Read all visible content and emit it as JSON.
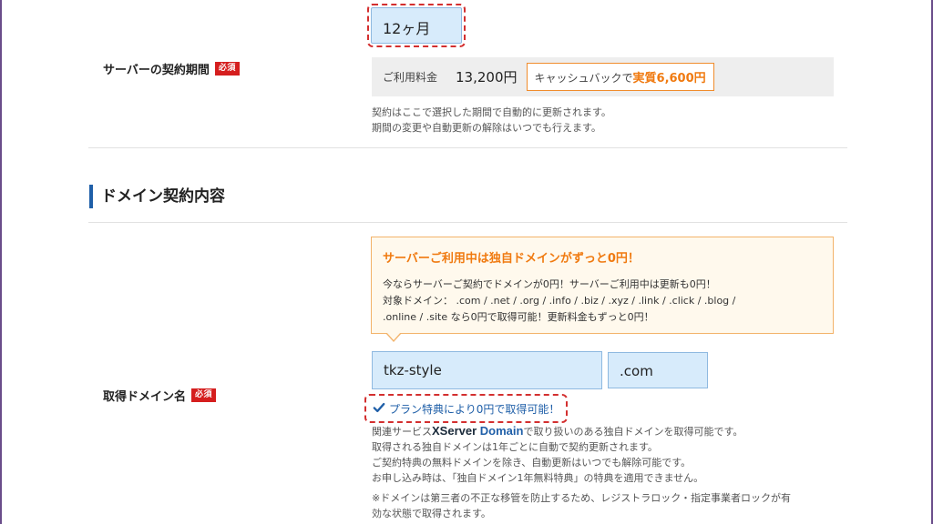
{
  "server_term": {
    "label": "サーバーの契約期間",
    "required_badge": "必須",
    "selected": "12ヶ月",
    "price_label": "ご利用料金",
    "price_value": "13,200円",
    "cashback_prefix": "キャッシュバックで",
    "cashback_value": "実質6,600円",
    "notes": [
      "契約はここで選択した期間で自動的に更新されます。",
      "期間の変更や自動更新の解除はいつでも行えます。"
    ]
  },
  "domain_section": {
    "title": "ドメイン契約内容"
  },
  "promo": {
    "title": "サーバーご利用中は独自ドメインがずっと0円！",
    "lines": [
      "今ならサーバーご契約でドメインが0円！サーバーご利用中は更新も0円！",
      "対象ドメイン： .com / .net / .org / .info / .biz / .xyz / .link / .click / .blog /",
      ".online / .site なら0円で取得可能！更新料金もずっと0円！"
    ]
  },
  "domain_field": {
    "label": "取得ドメイン名",
    "required_badge": "必須",
    "name_value": "tkz-style",
    "tld_value": ".com",
    "free_status": "プラン特典により0円で取得可能！",
    "desc_prefix": "関連サービス",
    "logo_x": "XServer",
    "logo_domain": "Domain",
    "desc_suffix": "で取り扱いのある独自ドメインを取得可能です。",
    "desc_lines": [
      "取得される独自ドメインは1年ごとに自動で契約更新されます。",
      "ご契約特典の無料ドメインを除き、自動更新はいつでも解除可能です。",
      "お申し込み時は、「独自ドメイン1年無料特典」の特典を適用できません。"
    ],
    "caution_lines": [
      "※ドメインは第三者の不正な移管を防止するため、レジストラロック・指定事業者ロックが有",
      "効な状態で取得されます。"
    ]
  },
  "colors": {
    "accent_blue": "#1f5fa8",
    "required_red": "#d51e1e",
    "promo_orange": "#f07a10",
    "input_bg": "#d7ebfb"
  }
}
